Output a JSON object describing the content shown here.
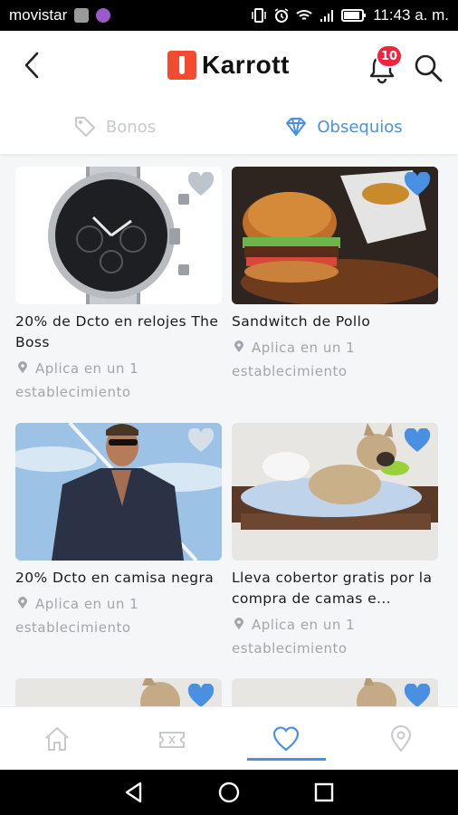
{
  "status_bar": {
    "carrier": "movistar",
    "time": "11:43 a. m."
  },
  "header": {
    "logo_text": "Karrott",
    "notification_count": "10"
  },
  "tabs": [
    {
      "label": "Bonos",
      "active": false
    },
    {
      "label": "Obsequios",
      "active": true
    }
  ],
  "cards": [
    {
      "title": "20% de Dcto en relojes The Boss",
      "meta": "Aplica en un 1 establecimiento",
      "favorite": false
    },
    {
      "title": "Sandwitch de Pollo",
      "meta": "Aplica en un 1 establecimiento",
      "favorite": true
    },
    {
      "title": "20% Dcto en camisa negra",
      "meta": "Aplica en un 1 establecimiento",
      "favorite": false
    },
    {
      "title": "Lleva cobertor gratis por la compra de camas e...",
      "meta": "Aplica en un 1 establecimiento",
      "favorite": true
    },
    {
      "title": "",
      "meta": "",
      "favorite": true
    },
    {
      "title": "",
      "meta": "",
      "favorite": true
    }
  ],
  "bottom_nav": [
    {
      "name": "home-icon",
      "active": false
    },
    {
      "name": "ticket-icon",
      "active": false
    },
    {
      "name": "heart-icon",
      "active": true
    },
    {
      "name": "location-icon",
      "active": false
    }
  ],
  "colors": {
    "accent": "#4a90e2",
    "badge": "#f0243f",
    "brand": "#f24b30",
    "inactive": "#c7c9cc"
  }
}
